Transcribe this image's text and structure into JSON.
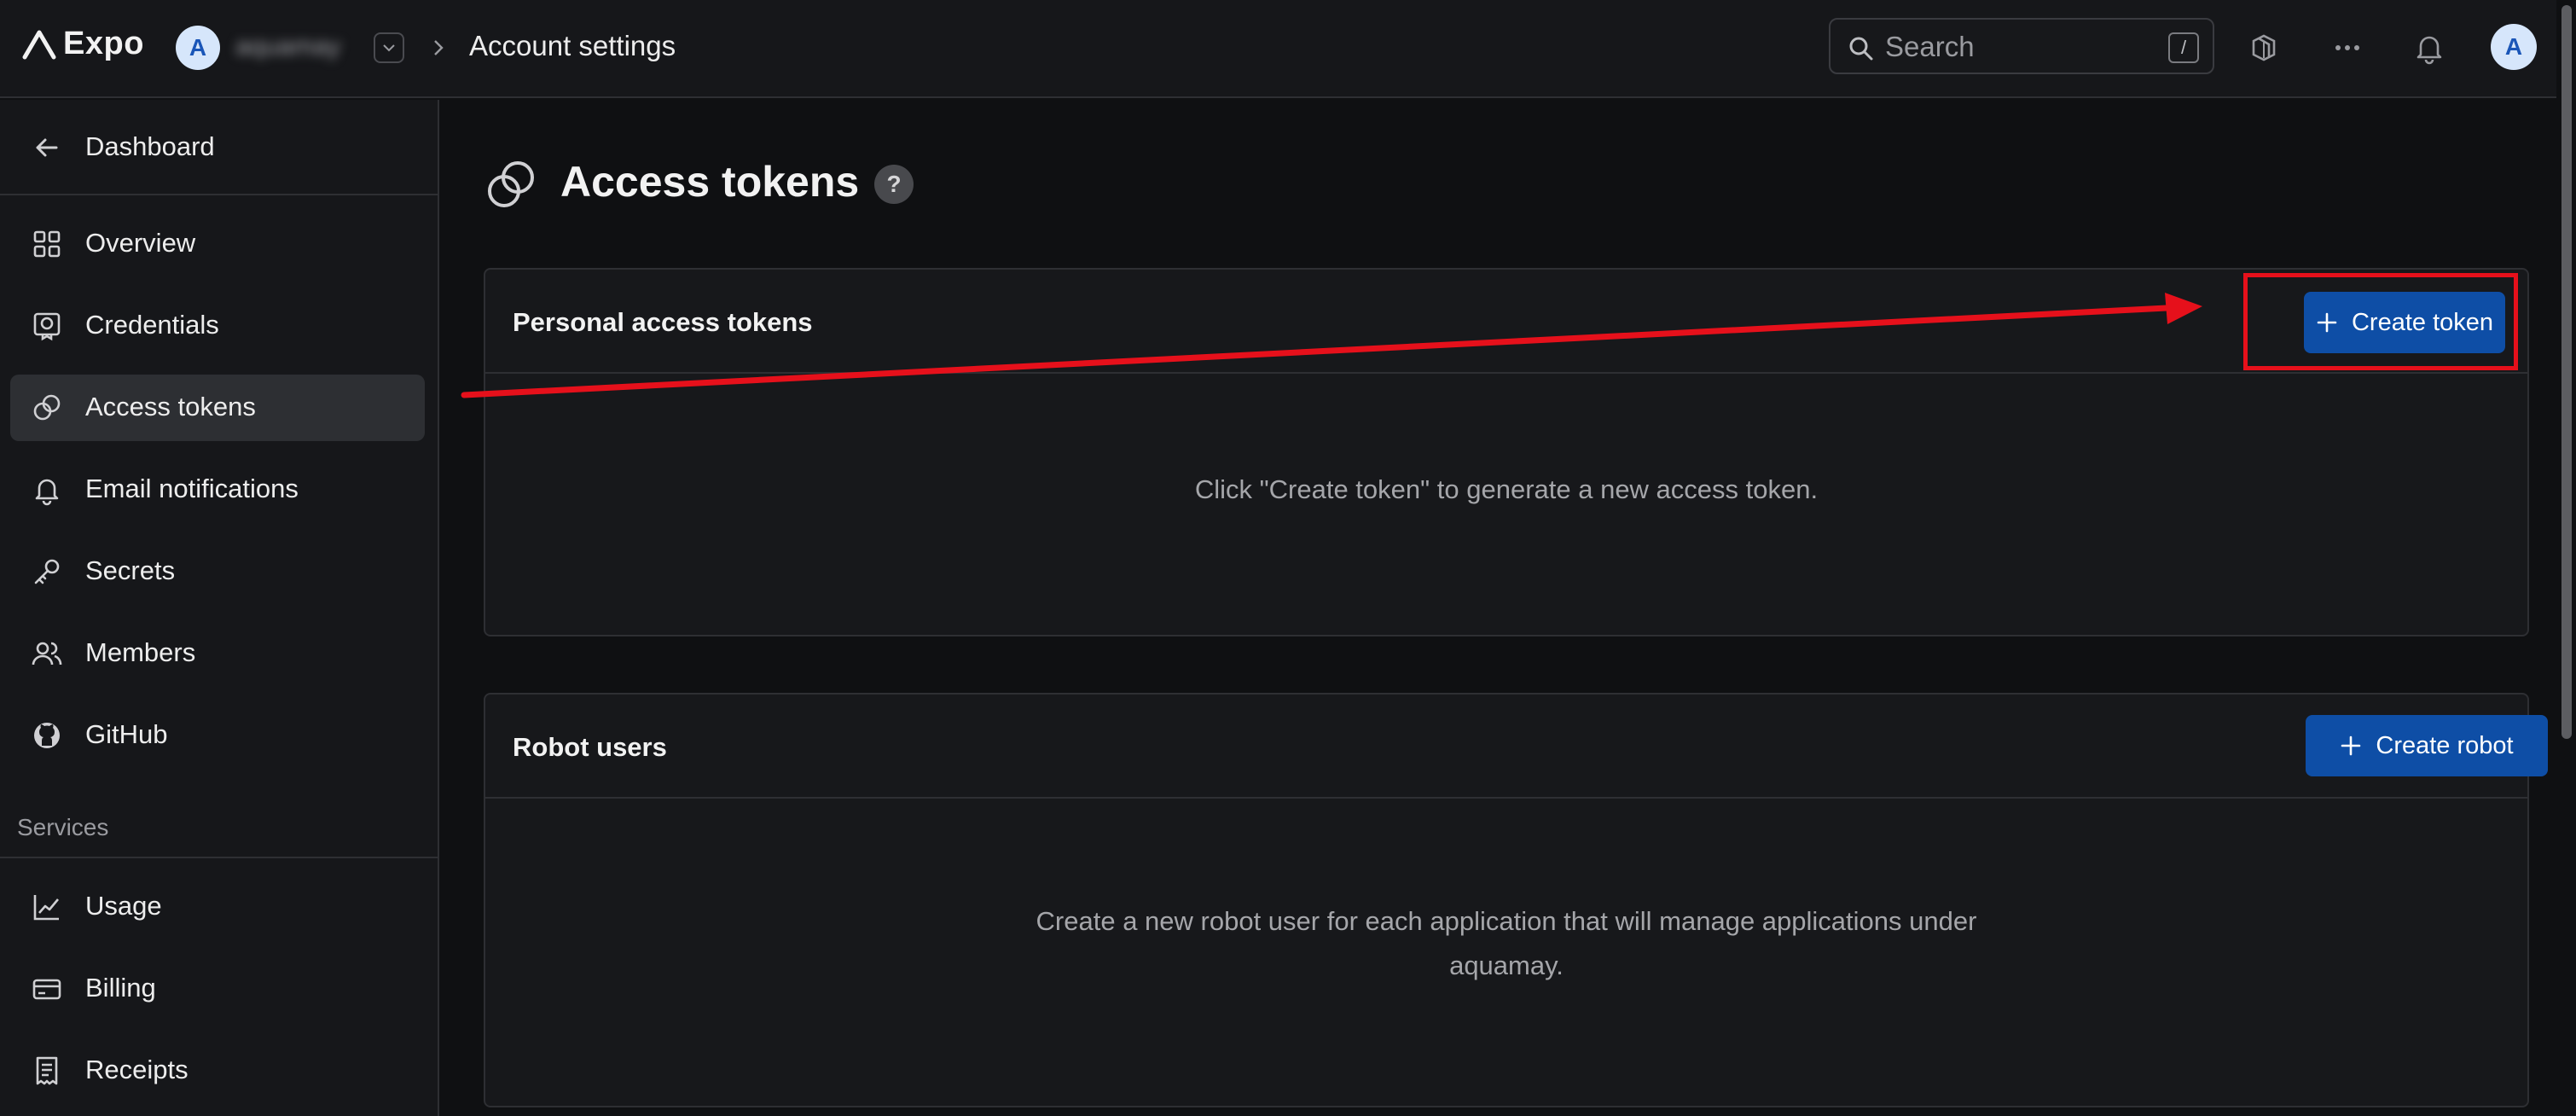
{
  "topbar": {
    "logo_text": "Expo",
    "account_avatar_letter": "A",
    "account_name": "aquamay",
    "breadcrumb_current": "Account settings",
    "search_placeholder": "Search",
    "search_shortcut": "/",
    "user_avatar_letter": "A"
  },
  "sidebar": {
    "back_label": "Dashboard",
    "items": [
      {
        "label": "Overview",
        "icon": "grid-icon"
      },
      {
        "label": "Credentials",
        "icon": "credentials-icon"
      },
      {
        "label": "Access tokens",
        "icon": "link-rings-icon",
        "active": true
      },
      {
        "label": "Email notifications",
        "icon": "bell-icon"
      },
      {
        "label": "Secrets",
        "icon": "key-icon"
      },
      {
        "label": "Members",
        "icon": "users-icon"
      },
      {
        "label": "GitHub",
        "icon": "github-icon"
      }
    ],
    "services_heading": "Services",
    "services": [
      {
        "label": "Usage",
        "icon": "chart-icon"
      },
      {
        "label": "Billing",
        "icon": "card-icon"
      },
      {
        "label": "Receipts",
        "icon": "receipt-icon"
      }
    ]
  },
  "main": {
    "title": "Access tokens",
    "help_label": "?",
    "personal_tokens": {
      "title": "Personal access tokens",
      "button_label": "Create token",
      "empty_text": "Click \"Create token\" to generate a new access token."
    },
    "robot_users": {
      "title": "Robot users",
      "button_label": "Create robot",
      "empty_line1": "Create a new robot user for each application that will manage applications under",
      "empty_line2": "aquamay."
    }
  },
  "colors": {
    "background": "#0f1012",
    "surface": "#17181b",
    "primary_button": "#0e4ea6",
    "annotation": "#e6101b"
  }
}
